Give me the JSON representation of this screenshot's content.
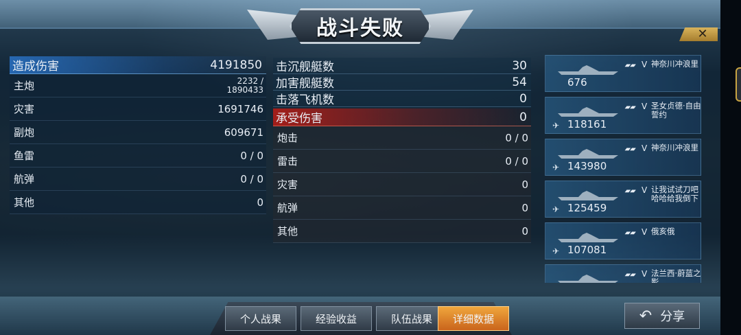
{
  "banner": {
    "title": "战斗失败"
  },
  "close_glyph": "✕",
  "left": {
    "total_label": "造成伤害",
    "total_value": "4191850",
    "rows": [
      {
        "label": "主炮",
        "value_line1": "2232 /",
        "value_line2": "1890433"
      },
      {
        "label": "灾害",
        "value": "1691746"
      },
      {
        "label": "副炮",
        "value": "609671"
      },
      {
        "label": "鱼雷",
        "value": "0 / 0"
      },
      {
        "label": "航弹",
        "value": "0 / 0"
      },
      {
        "label": "其他",
        "value": "0"
      }
    ]
  },
  "middle": {
    "rows": [
      {
        "label": "击沉舰艇数",
        "value": "30"
      },
      {
        "label": "加害舰艇数",
        "value": "54"
      },
      {
        "label": "击落飞机数",
        "value": "0"
      }
    ],
    "taken_label": "承受伤害",
    "taken_value": "0",
    "taken_rows": [
      {
        "label": "炮击",
        "value": "0 / 0"
      },
      {
        "label": "雷击",
        "value": "0 / 0"
      },
      {
        "label": "灾害",
        "value": "0"
      },
      {
        "label": "航弹",
        "value": "0"
      },
      {
        "label": "其他",
        "value": "0"
      }
    ]
  },
  "players": [
    {
      "tier": "V",
      "name": "神奈川冲浪里",
      "score": "676",
      "has_plane": false
    },
    {
      "tier": "V",
      "name": "圣女贞德·自由誓约",
      "score": "118161",
      "has_plane": true
    },
    {
      "tier": "V",
      "name": "神奈川冲浪里",
      "score": "143980",
      "has_plane": true
    },
    {
      "tier": "V",
      "name": "让我试试刀吧哈哈给我倒下",
      "score": "125459",
      "has_plane": true
    },
    {
      "tier": "V",
      "name": "俄亥俄",
      "score": "107081",
      "has_plane": true
    },
    {
      "tier": "V",
      "name": "法兰西·蔚蓝之影",
      "score": "",
      "has_plane": false
    }
  ],
  "tabs": [
    "个人战果",
    "经验收益",
    "队伍战果",
    "详细数据"
  ],
  "active_tab_index": 3,
  "share": {
    "label": "分享",
    "icon": "share-back-arrow-icon"
  },
  "colors": {
    "active_tab": "#e8891f",
    "damage_dealt_header": "#2a6fbf",
    "damage_taken_header": "#a8201a"
  }
}
